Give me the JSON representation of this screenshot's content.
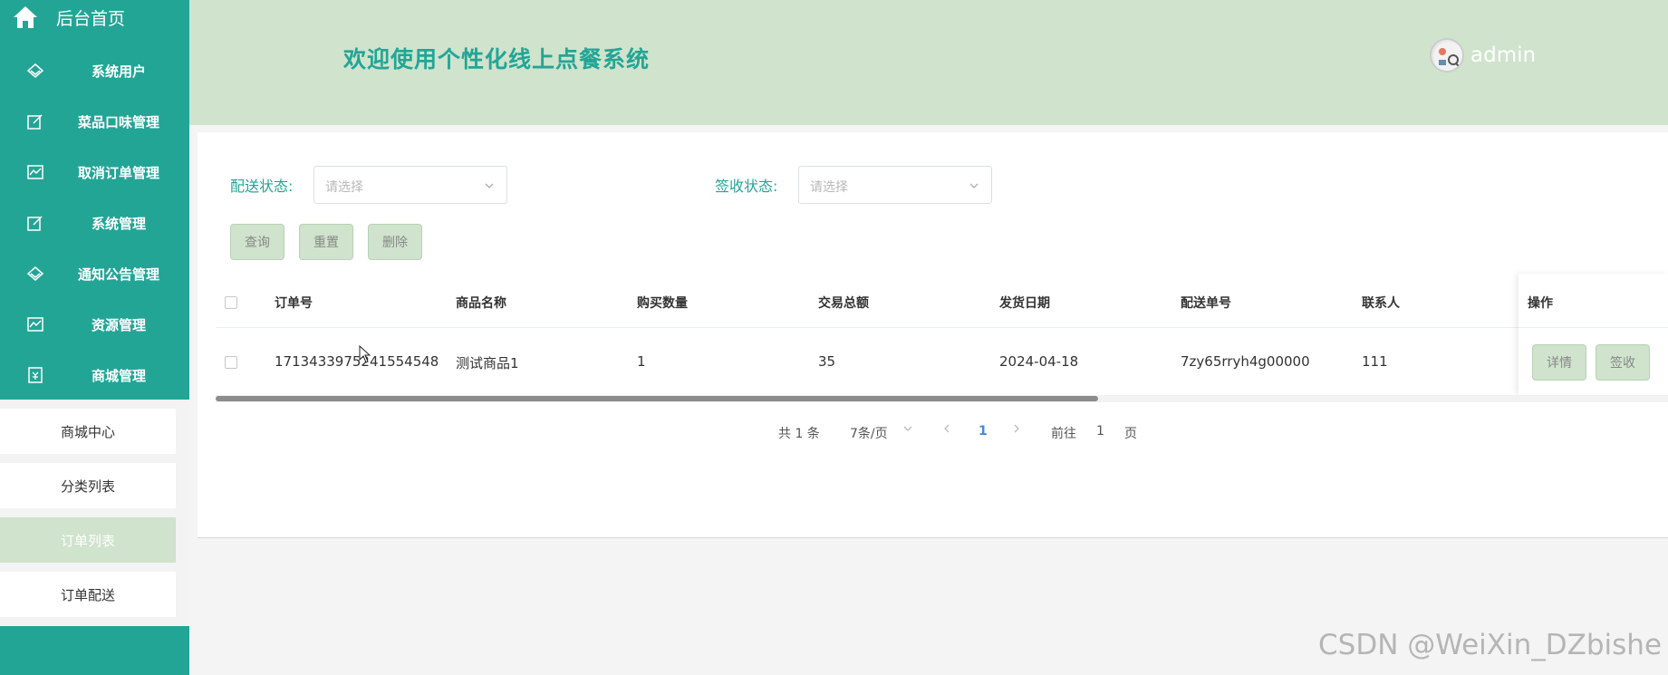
{
  "sidebar": {
    "home_label": "后台首页",
    "menu": [
      {
        "label": "系统用户",
        "icon": "diamond-icon"
      },
      {
        "label": "菜品口味管理",
        "icon": "edit-icon"
      },
      {
        "label": "取消订单管理",
        "icon": "chart-icon"
      },
      {
        "label": "系统管理",
        "icon": "edit-icon"
      },
      {
        "label": "通知公告管理",
        "icon": "diamond-icon"
      },
      {
        "label": "资源管理",
        "icon": "chart-icon"
      },
      {
        "label": "商城管理",
        "icon": "shop-icon"
      }
    ],
    "submenu": [
      "商城中心",
      "分类列表",
      "订单列表",
      "订单配送"
    ],
    "active_submenu": "订单列表"
  },
  "header": {
    "title": "欢迎使用个性化线上点餐系统",
    "username": "admin"
  },
  "filters": {
    "delivery_label": "配送状态:",
    "delivery_placeholder": "请选择",
    "receipt_label": "签收状态:",
    "receipt_placeholder": "请选择"
  },
  "actions": {
    "query": "查询",
    "reset": "重置",
    "delete": "删除"
  },
  "table": {
    "columns": [
      "订单号",
      "商品名称",
      "购买数量",
      "交易总额",
      "发货日期",
      "配送单号",
      "联系人",
      "操作"
    ],
    "rows": [
      {
        "order_no": "1713433975241554548",
        "product": "测试商品1",
        "quantity": "1",
        "total": "35",
        "ship_date": "2024-04-18",
        "delivery_no": "7zy65rryh4g00000",
        "contact": "111",
        "detail_label": "详情",
        "sign_label": "签收"
      }
    ]
  },
  "pagination": {
    "total": "共 1 条",
    "page_size": "7条/页",
    "current_page": "1",
    "goto_prefix": "前往",
    "goto_value": "1",
    "goto_suffix": "页"
  },
  "watermark": "CSDN @WeiXin_DZbishe",
  "colors": {
    "primary": "#23a596",
    "header_bg": "#cfe3cd",
    "button_bg": "#cfe3cd",
    "active_page": "#3a8ee6"
  }
}
